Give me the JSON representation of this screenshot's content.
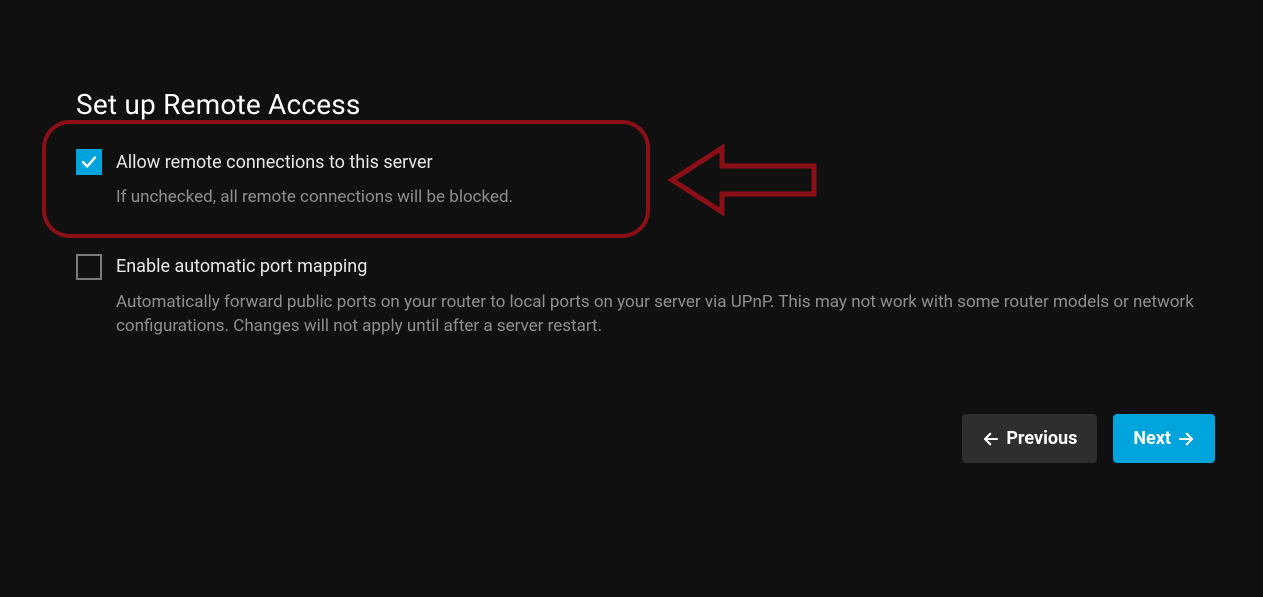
{
  "page": {
    "title": "Set up Remote Access"
  },
  "settings": {
    "allow_remote": {
      "label": "Allow remote connections to this server",
      "description": "If unchecked, all remote connections will be blocked.",
      "checked": true
    },
    "auto_port_mapping": {
      "label": "Enable automatic port mapping",
      "description": "Automatically forward public ports on your router to local ports on your server via UPnP. This may not work with some router models or network configurations. Changes will not apply until after a server restart.",
      "checked": false
    }
  },
  "buttons": {
    "previous": "Previous",
    "next": "Next"
  },
  "colors": {
    "accent": "#00a4dc",
    "annotation": "#8b0f16",
    "bg": "#101010",
    "secondary_btn": "#2e2e2e"
  }
}
